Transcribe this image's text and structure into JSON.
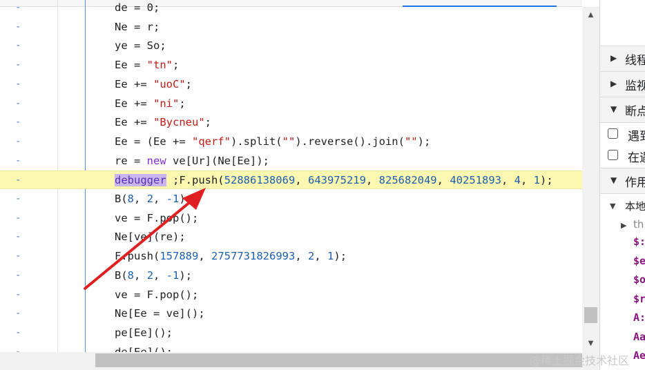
{
  "editor": {
    "lines": [
      {
        "tokens": [
          {
            "t": "de = 0;",
            "c": ""
          }
        ]
      },
      {
        "tokens": [
          {
            "t": "Ne = r;",
            "c": ""
          }
        ]
      },
      {
        "tokens": [
          {
            "t": "ye = So;",
            "c": ""
          }
        ]
      },
      {
        "tokens": [
          {
            "t": "Ee = ",
            "c": ""
          },
          {
            "t": "\"tn\"",
            "c": "str"
          },
          {
            "t": ";",
            "c": ""
          }
        ]
      },
      {
        "tokens": [
          {
            "t": "Ee += ",
            "c": ""
          },
          {
            "t": "\"uoC\"",
            "c": "str"
          },
          {
            "t": ";",
            "c": ""
          }
        ]
      },
      {
        "tokens": [
          {
            "t": "Ee += ",
            "c": ""
          },
          {
            "t": "\"ni\"",
            "c": "str"
          },
          {
            "t": ";",
            "c": ""
          }
        ]
      },
      {
        "tokens": [
          {
            "t": "Ee += ",
            "c": ""
          },
          {
            "t": "\"Bycneu\"",
            "c": "str"
          },
          {
            "t": ";",
            "c": ""
          }
        ]
      },
      {
        "tokens": [
          {
            "t": "Ee = (Ee += ",
            "c": ""
          },
          {
            "t": "\"qerf\"",
            "c": "str"
          },
          {
            "t": ").split(",
            "c": ""
          },
          {
            "t": "\"\"",
            "c": "str"
          },
          {
            "t": ").reverse().join(",
            "c": ""
          },
          {
            "t": "\"\"",
            "c": "str"
          },
          {
            "t": ");",
            "c": ""
          }
        ]
      },
      {
        "tokens": [
          {
            "t": "re = ",
            "c": ""
          },
          {
            "t": "new",
            "c": "kw"
          },
          {
            "t": " ve[Ur](Ne[Ee]);",
            "c": ""
          }
        ]
      },
      {
        "highlight": true,
        "tokens": [
          {
            "t": "debugger",
            "c": "kw dbg"
          },
          {
            "t": " ;F.push(",
            "c": ""
          },
          {
            "t": "52886138069",
            "c": "num"
          },
          {
            "t": ", ",
            "c": ""
          },
          {
            "t": "643975219",
            "c": "num"
          },
          {
            "t": ", ",
            "c": ""
          },
          {
            "t": "825682049",
            "c": "num"
          },
          {
            "t": ", ",
            "c": ""
          },
          {
            "t": "40251893",
            "c": "num"
          },
          {
            "t": ", ",
            "c": ""
          },
          {
            "t": "4",
            "c": "num"
          },
          {
            "t": ", ",
            "c": ""
          },
          {
            "t": "1",
            "c": "num"
          },
          {
            "t": ");",
            "c": ""
          }
        ]
      },
      {
        "tokens": [
          {
            "t": "B(",
            "c": ""
          },
          {
            "t": "8",
            "c": "num"
          },
          {
            "t": ", ",
            "c": ""
          },
          {
            "t": "2",
            "c": "num"
          },
          {
            "t": ", ",
            "c": ""
          },
          {
            "t": "-1",
            "c": "num"
          },
          {
            "t": ");",
            "c": ""
          }
        ]
      },
      {
        "tokens": [
          {
            "t": "ve = F.pop();",
            "c": ""
          }
        ]
      },
      {
        "tokens": [
          {
            "t": "Ne[ve](re);",
            "c": ""
          }
        ]
      },
      {
        "tokens": [
          {
            "t": "F.push(",
            "c": ""
          },
          {
            "t": "157889",
            "c": "num"
          },
          {
            "t": ", ",
            "c": ""
          },
          {
            "t": "2757731826993",
            "c": "num"
          },
          {
            "t": ", ",
            "c": ""
          },
          {
            "t": "2",
            "c": "num"
          },
          {
            "t": ", ",
            "c": ""
          },
          {
            "t": "1",
            "c": "num"
          },
          {
            "t": ");",
            "c": ""
          }
        ]
      },
      {
        "tokens": [
          {
            "t": "B(",
            "c": ""
          },
          {
            "t": "8",
            "c": "num"
          },
          {
            "t": ", ",
            "c": ""
          },
          {
            "t": "2",
            "c": "num"
          },
          {
            "t": ", ",
            "c": ""
          },
          {
            "t": "-1",
            "c": "num"
          },
          {
            "t": ");",
            "c": ""
          }
        ]
      },
      {
        "tokens": [
          {
            "t": "ve = F.pop();",
            "c": ""
          }
        ]
      },
      {
        "tokens": [
          {
            "t": "Ne[Ee = ve]();",
            "c": ""
          }
        ]
      },
      {
        "tokens": [
          {
            "t": "pe[Ee]();",
            "c": ""
          }
        ]
      },
      {
        "tokens": [
          {
            "t": "de[Ee]();",
            "c": ""
          }
        ]
      }
    ],
    "gutter_mark": "-"
  },
  "scrollbar": {
    "up_icon": "▲",
    "down_icon": "▼"
  },
  "panel": {
    "sections": [
      {
        "label": "线程",
        "expanded": false
      },
      {
        "label": "监视",
        "expanded": false
      },
      {
        "label": "断点",
        "expanded": true
      }
    ],
    "checkboxes": [
      "遇到",
      "在遇"
    ],
    "scope_section": {
      "label": "作用",
      "expanded": true
    },
    "local_label": "本地",
    "this_label": "th",
    "props": [
      "$:",
      "$e",
      "$o",
      "$r",
      "A:",
      "Aa",
      "Ae"
    ]
  },
  "watermark": "@稀土掘金技术社区",
  "colors": {
    "accent": "#1a73e8",
    "highlight": "#fbf7b0",
    "arrow": "#e02020"
  }
}
